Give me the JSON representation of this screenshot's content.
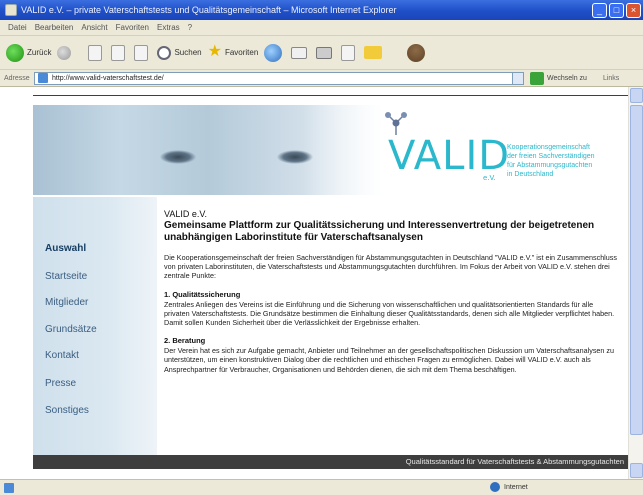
{
  "window": {
    "title": "VALID e.V. – private Vaterschaftstests und Qualitätsgemeinschaft – Microsoft Internet Explorer",
    "minimize": "_",
    "maximize": "□",
    "close": "×"
  },
  "menu": [
    "Datei",
    "Bearbeiten",
    "Ansicht",
    "Favoriten",
    "Extras",
    "?"
  ],
  "toolbar": {
    "back": "Zurück",
    "search": "Suchen",
    "favorites": "Favoriten"
  },
  "address": {
    "label": "Adresse",
    "url": "http://www.valid-vaterschaftstest.de/",
    "go": "Wechseln zu",
    "links": "Links"
  },
  "banner": {
    "logo_text": "VALID",
    "logo_suffix": "e.V.",
    "association": [
      "Kooperationsgemeinschaft",
      "der freien Sachverständigen",
      "für Abstammungsgutachten",
      "in Deutschland"
    ]
  },
  "sidebar": {
    "items": [
      "Auswahl",
      "Startseite",
      "Mitglieder",
      "Grundsätze",
      "Kontakt",
      "Presse",
      "Sonstiges"
    ]
  },
  "main": {
    "org": "VALID e.V.",
    "headline": "Gemeinsame Plattform zur Qualitätssicherung und Interessenvertretung der beigetretenen unabhängigen Laborinstitute für Vaterschaftsanalysen",
    "intro": "Die Kooperationsgemeinschaft der freien Sachverständigen für Abstammungsgutachten in Deutschland \"VALID e.V.\" ist ein Zusammenschluss von privaten Laborinstituten, die Vaterschaftstests und Abstammungsgutachten durchführen. Im Fokus der Arbeit von VALID e.V. stehen drei zentrale Punkte:",
    "section1_title": "1. Qualitätssicherung",
    "section1_text": "Zentrales Anliegen des Vereins ist die Einführung und die Sicherung von wissenschaftlichen und qualitätsorientierten Standards für alle privaten Vaterschaftstests. Die Grundsätze bestimmen die Einhaltung dieser Qualitätsstandards, denen sich alle Mitglieder verpflichtet haben. Damit sollen Kunden Sicherheit über die Verlässlichkeit der Ergebnisse erhalten.",
    "section2_title": "2. Beratung",
    "section2_text": "Der Verein hat es sich zur Aufgabe gemacht, Anbieter und Teilnehmer an der gesellschaftspolitischen Diskussion um Vaterschaftsanalysen zu unterstützen, um einen konstruktiven Dialog über die rechtlichen und ethischen Fragen zu ermöglichen. Dabei will VALID e.V. auch als Ansprechpartner für Verbraucher, Organisationen und Behörden dienen, die sich mit dem Thema beschäftigen."
  },
  "footer": {
    "text": "Qualitätsstandard für Vaterschaftstests & Abstammungsgutachten"
  },
  "status": {
    "zone": "Internet"
  }
}
